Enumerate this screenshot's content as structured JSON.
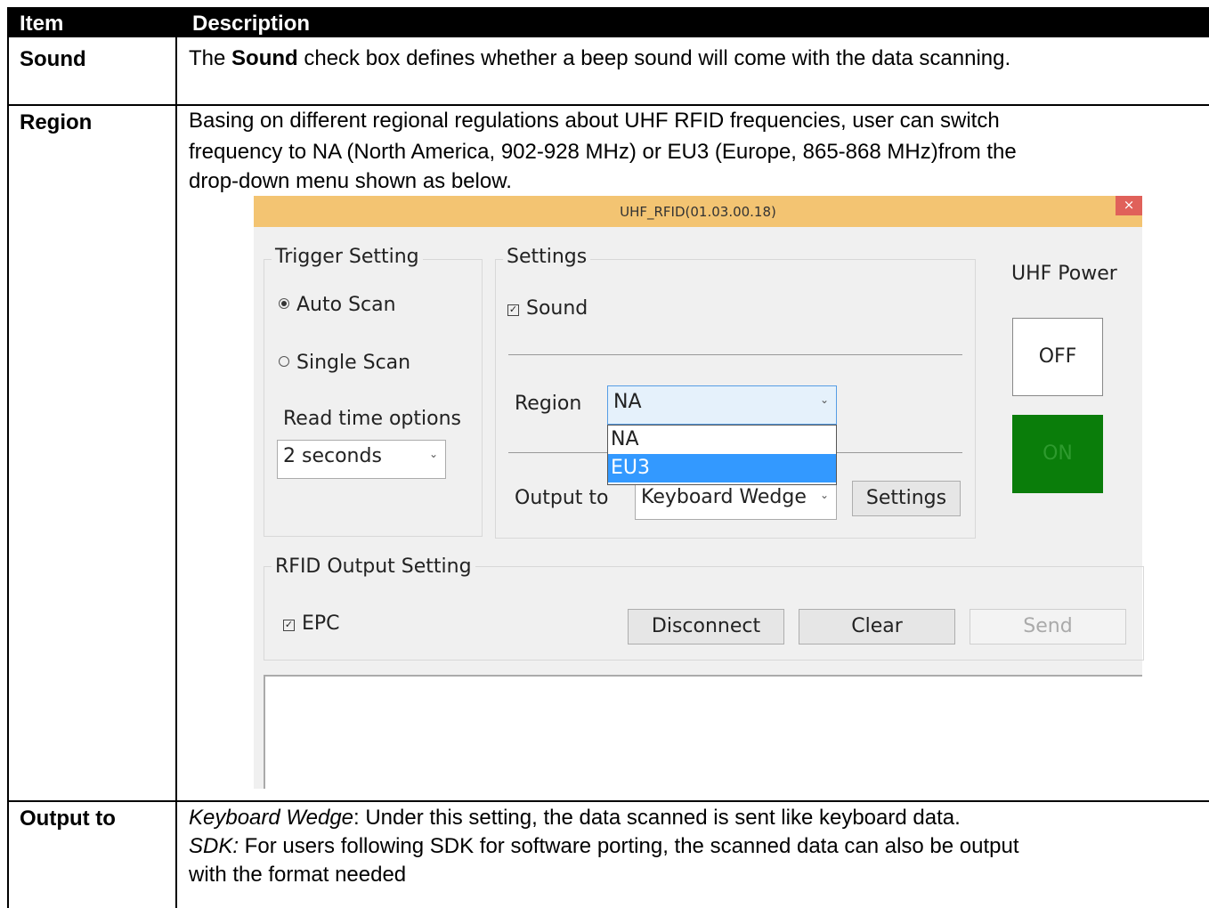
{
  "table": {
    "header": {
      "item": "Item",
      "description": "Description"
    },
    "rows": {
      "sound": {
        "label": "Sound",
        "text_pre": "The ",
        "text_bold": "Sound",
        "text_post": " check box defines whether a beep sound will come with the data scanning."
      },
      "region": {
        "label": "Region",
        "line1": "Basing on different regional regulations about UHF RFID frequencies, user can switch",
        "line2": "frequency to NA (North America, 902-928 MHz) or EU3 (Europe, 865-868 MHz)from the",
        "line3": "drop-down menu shown as below."
      },
      "output": {
        "label": "Output to",
        "line1_italic": "Keyboard Wedge",
        "line1_rest": ": Under this setting, the data scanned is sent like keyboard data.",
        "line2_italic": "SDK:",
        "line2_rest": " For users following SDK for software porting, the scanned data can also be output",
        "line3": "with the format needed"
      }
    }
  },
  "dialog": {
    "title": "UHF_RFID(01.03.00.18)",
    "close": "×",
    "trigger_setting": {
      "label": "Trigger Setting",
      "auto_scan": "Auto Scan",
      "single_scan": "Single Scan",
      "read_time_label": "Read time options",
      "read_time_value": "2 seconds"
    },
    "settings": {
      "label": "Settings",
      "sound": "Sound",
      "region_label": "Region",
      "region_value": "NA",
      "region_options": [
        "NA",
        "EU3"
      ],
      "output_label": "Output to",
      "output_value": "Keyboard Wedge",
      "settings_button": "Settings"
    },
    "power": {
      "label": "UHF Power",
      "off": "OFF",
      "on": "ON",
      "on_color": "#0a7d0a"
    },
    "rfid_output": {
      "label": "RFID Output Setting",
      "epc": "EPC",
      "disconnect": "Disconnect",
      "clear": "Clear",
      "send": "Send"
    }
  }
}
